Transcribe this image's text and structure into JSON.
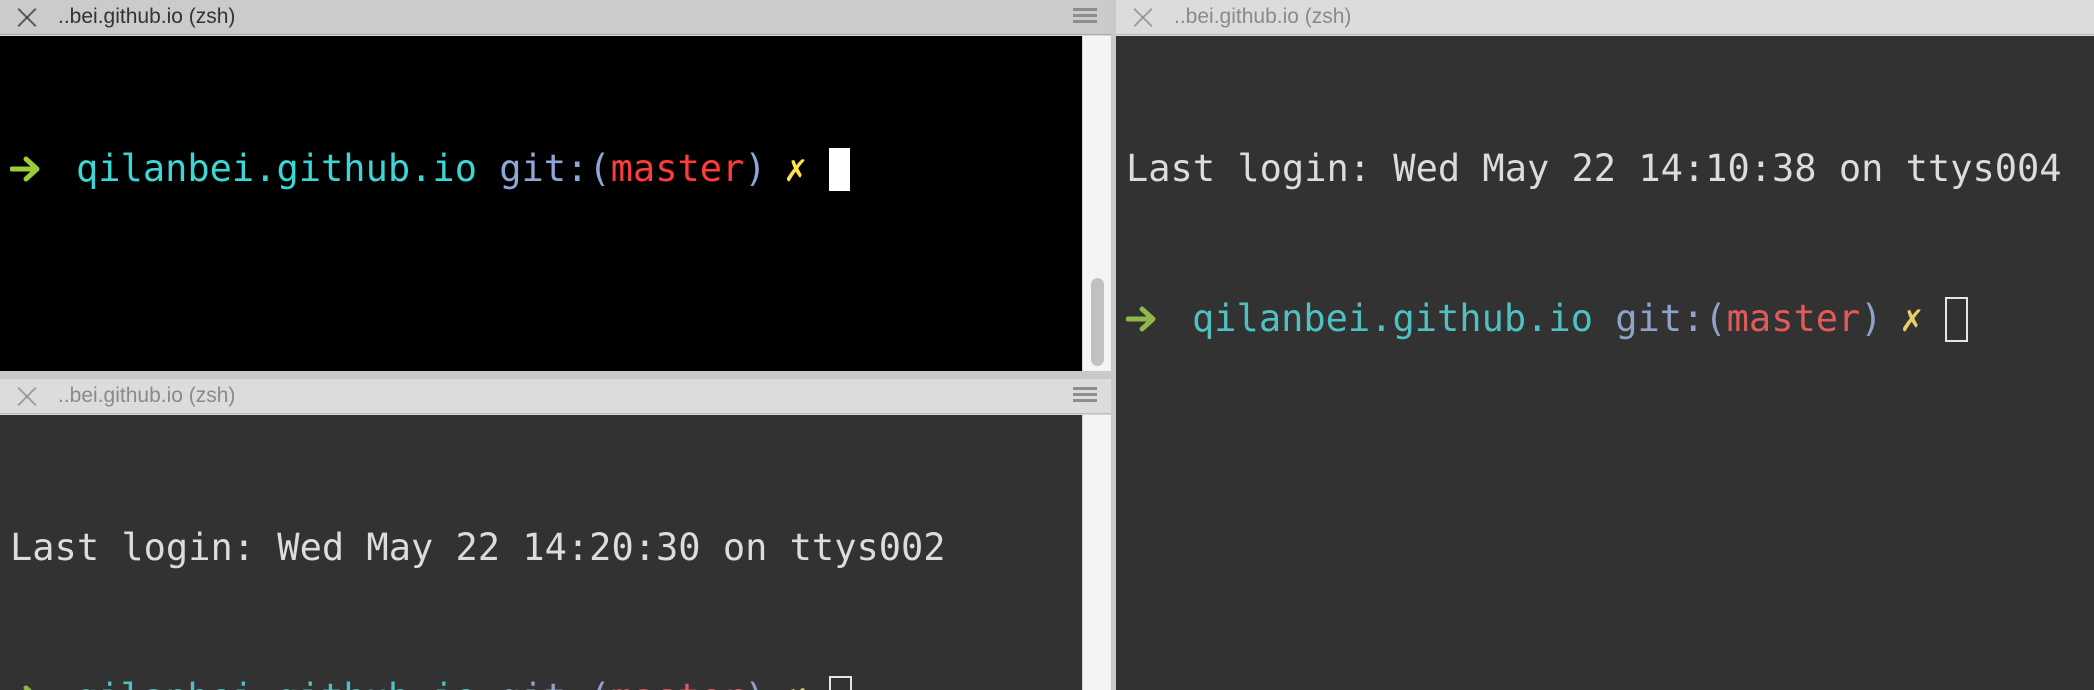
{
  "panes": {
    "top_left": {
      "title": "..bei.github.io (zsh)",
      "state": "active",
      "prompt": {
        "dir": "qilanbei.github.io",
        "git_prefix": "git:",
        "paren_open": "(",
        "branch": "master",
        "paren_close": ")",
        "dirty_symbol": "✗"
      },
      "scroll_position": 0.78
    },
    "bottom_left": {
      "title": "..bei.github.io (zsh)",
      "state": "inactive",
      "last_login": "Last login: Wed May 22 14:20:30 on ttys002",
      "prompt": {
        "dir": "qilanbei.github.io",
        "git_prefix": "git:",
        "paren_open": "(",
        "branch": "master",
        "paren_close": ")",
        "dirty_symbol": "✗"
      }
    },
    "right": {
      "title": "..bei.github.io (zsh)",
      "state": "inactive",
      "last_login": "Last login: Wed May 22 14:10:38 on ttys004",
      "prompt": {
        "dir": "qilanbei.github.io",
        "git_prefix": "git:",
        "paren_open": "(",
        "branch": "master",
        "paren_close": ")",
        "dirty_symbol": "✗"
      }
    }
  },
  "icons": {
    "close": "close-icon",
    "menu": "menu-icon",
    "prompt_arrow": "arrow-right-icon",
    "dirty": "dirty-x-icon"
  },
  "colors": {
    "arrow": "#9ccc3c",
    "dir": "#3bd6d6",
    "git": "#8fa6d9",
    "branch": "#ff3b3b",
    "dirty": "#ffe24a"
  }
}
